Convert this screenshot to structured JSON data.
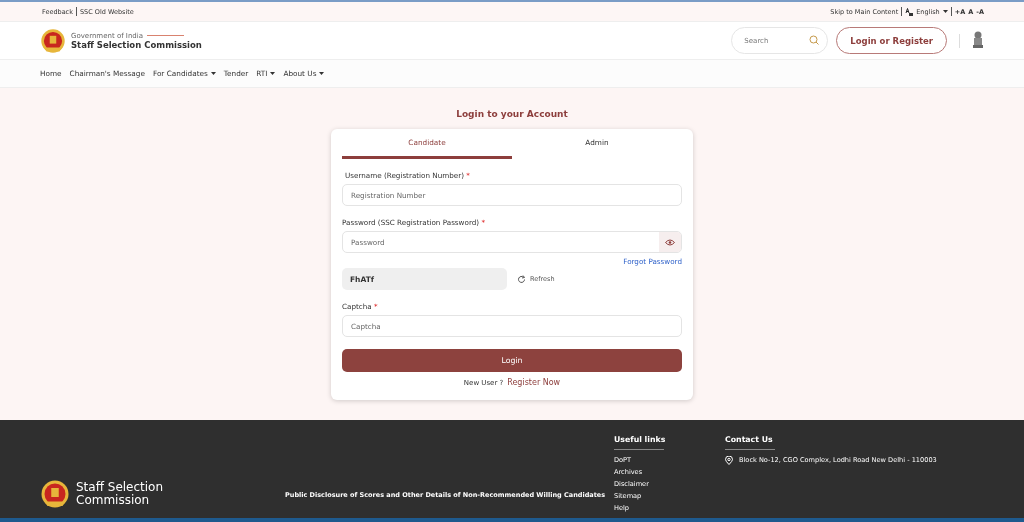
{
  "top_bar": {
    "left_links": [
      "Feedback",
      "SSC Old Website"
    ],
    "skip_link": "Skip to Main Content",
    "language": "English",
    "font_sizes": [
      "+A",
      "A",
      "-A"
    ]
  },
  "header": {
    "org_line": "Government of India",
    "org_name": "Staff Selection Commission",
    "search": {
      "placeholder": "Search"
    },
    "login_button": "Login or Register"
  },
  "nav": [
    {
      "label": "Home",
      "has_menu": false
    },
    {
      "label": "Chairman's Message",
      "has_menu": false
    },
    {
      "label": "For Candidates",
      "has_menu": true
    },
    {
      "label": "Tender",
      "has_menu": false
    },
    {
      "label": "RTI",
      "has_menu": true
    },
    {
      "label": "About Us",
      "has_menu": true
    }
  ],
  "login": {
    "title": "Login to your Account",
    "tabs": [
      {
        "label": "Candidate",
        "selected": true
      },
      {
        "label": "Admin",
        "selected": false
      }
    ],
    "username": {
      "label": "Username (Registration Number)",
      "required_mark": "*",
      "placeholder": "Registration Number"
    },
    "password": {
      "label": "Password (SSC Registration Password)",
      "required_mark": "*",
      "placeholder": "Password"
    },
    "forgot_link": "Forgot Password",
    "captcha_code": "FhATf",
    "refresh": "Refresh",
    "captcha": {
      "label": "Captcha",
      "required_mark": "*",
      "placeholder": "Captcha"
    },
    "submit": "Login",
    "new_user": "New User ?",
    "register_link": "Register Now"
  },
  "footer": {
    "brand": "Staff Selection Commission",
    "disclosure_link": "Public Disclosure of Scores and Other Details of Non-Recommended Willing Candidates",
    "useful_links_title": "Useful links",
    "useful_links": [
      "DoPT",
      "Archives",
      "Disclaimer",
      "Sitemap",
      "Help"
    ],
    "contact_title": "Contact Us",
    "address": "Block No-12, CGO Complex, Lodhi Road New Delhi - 110003"
  }
}
